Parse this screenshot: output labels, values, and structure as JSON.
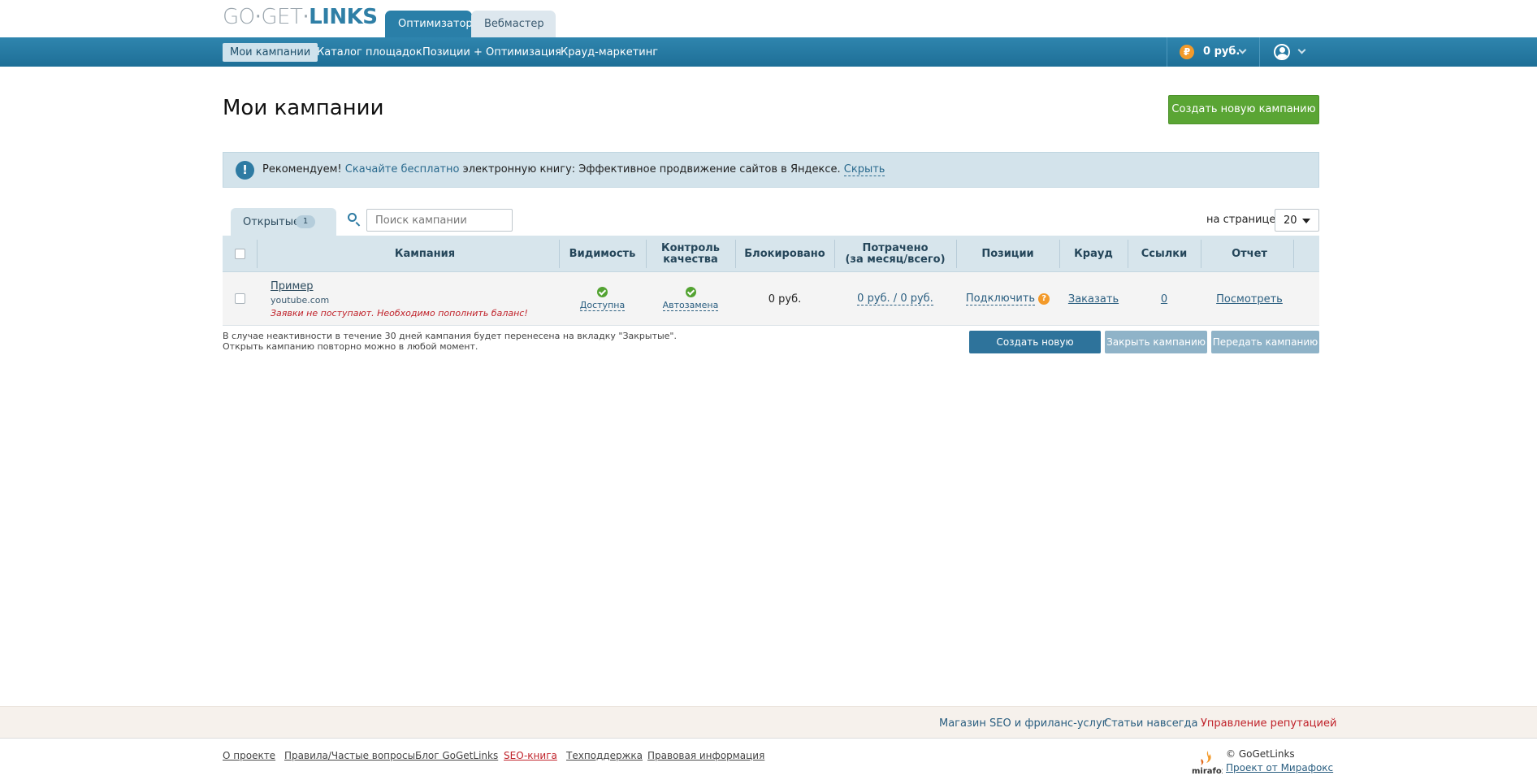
{
  "logo": {
    "go": "GO",
    "get": "GET",
    "links": "LINKS"
  },
  "role_tabs": {
    "active": "Оптимизатор",
    "inactive": "Вебмастер"
  },
  "nav": {
    "items": [
      "Мои кампании",
      "Каталог площадок",
      "Позиции + Оптимизация",
      "Крауд-маркетинг"
    ],
    "currency_symbol": "₽",
    "balance": "0 руб."
  },
  "page": {
    "title": "Мои кампании",
    "create_button": "Создать новую кампанию"
  },
  "notice": {
    "icon": "!",
    "prefix": "Рекомендуем!",
    "link": "Скачайте бесплатно",
    "text": "электронную книгу: Эффективное продвижение сайтов в Яндексе.",
    "hide": "Скрыть"
  },
  "tabs": {
    "open_label": "Открытые",
    "open_count": "1"
  },
  "search": {
    "placeholder": "Поиск кампании"
  },
  "per_page": {
    "label": "на странице",
    "value": "20"
  },
  "table": {
    "headers": {
      "campaign": "Кампания",
      "visibility": "Видимость",
      "quality_1": "Контроль",
      "quality_2": "качества",
      "blocked": "Блокировано",
      "spent_1": "Потрачено",
      "spent_2": "(за месяц/всего)",
      "positions": "Позиции",
      "crowd": "Крауд",
      "links": "Ссылки",
      "report": "Отчет"
    },
    "rows": [
      {
        "name": "Пример",
        "domain": "youtube.com",
        "warning": "Заявки не поступают. Необходимо",
        "warning_link": "пополнить баланс",
        "warning_end": "!",
        "visibility": "Доступна",
        "quality": "Автозамена",
        "blocked": "0 руб.",
        "spent": "0 руб. / 0 руб.",
        "positions": "Подключить",
        "help": "?",
        "crowd": "Заказать",
        "links": "0",
        "report": "Посмотреть"
      }
    ]
  },
  "footer_note": {
    "line1": "В случае неактивности в течение 30 дней кампания будет перенесена на вкладку \"Закрытые\".",
    "line2": "Открыть кампанию повторно можно в любой момент."
  },
  "actions": {
    "create": "Создать новую кампанию",
    "close": "Закрыть кампанию",
    "transfer": "Передать кампанию"
  },
  "footer": {
    "top_links": [
      "Магазин SEO и фриланс-услуг",
      "Статьи навсегда",
      "Управление репутацией"
    ],
    "bottom_links": [
      "О проекте",
      "Правила/Частые вопросы",
      "Блог GoGetLinks",
      "SEO-книга",
      "Техподдержка",
      "Правовая информация"
    ],
    "copyright": "© GoGetLinks",
    "project": "Проект от Мирафокс",
    "mirafox": "mirafox"
  },
  "colors": {
    "nav_blue": "#2a7fa8",
    "green_button": "#5aa534",
    "notice_bg": "#d3e3eb",
    "warning_red": "#c0222a",
    "accent_orange": "#f39a2a"
  }
}
